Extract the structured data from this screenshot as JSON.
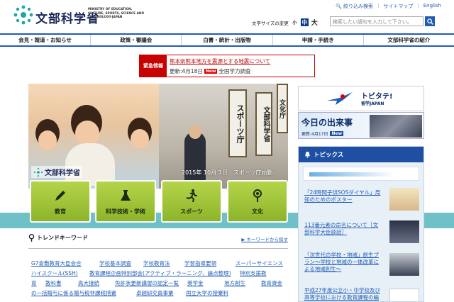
{
  "header": {
    "logo_text": "文部科学省",
    "logo_en": "MINISTRY OF EDUCATION, CULTURE, SPORTS, SCIENCE AND TECHNOLOGY-JAPAN",
    "top_links": [
      "絞り込み検索",
      "サイトマップ",
      "English"
    ],
    "font_size_label": "文字サイズの変更",
    "font_sizes": [
      "小",
      "中",
      "大"
    ],
    "search_placeholder": "検索したい語句を入力して下さい。"
  },
  "nav": [
    "会見・報道・お知らせ",
    "政策・審議会",
    "白書・統計・出版物",
    "申請・手続き",
    "文部科学省の紹介"
  ],
  "emergency": {
    "tag": "緊急情報",
    "line1": "熊本県熊本地方を震源とする地震について",
    "updated": "更新:4月18日",
    "new_badge": "New",
    "line2_text": "全国学力調査"
  },
  "hero": {
    "caption": "2015年 10月 1日　スポーツ庁始動",
    "sign_right": "スポーツ庁",
    "sign_left": "文部科学省",
    "sign_far": "文化庁",
    "logo_text": "文部科学省"
  },
  "tiles": [
    "教育",
    "科学技術・学術",
    "スポーツ",
    "文化"
  ],
  "trend": {
    "title": "トレンドキーワード",
    "more": "キーワードから探す",
    "keywords": [
      "G7倉敷教育大臣会合",
      "学校基本調査",
      "学校教育法",
      "学習指導要領",
      "スーパーサイエンス",
      "ハイスクール(SSH)",
      "教育課程企画特別部会(アクティブ・ラーニング、論点整理)",
      "特別支援教",
      "育",
      "教科書",
      "高大接続",
      "免許状更新講習の認定一覧",
      "奨学金",
      "地方創生",
      "教育資金",
      "の一括贈与に係る贈与税非課税措置",
      "卓越研究員事業",
      "国立大学の授業料"
    ]
  },
  "right": {
    "tobitate_title": "トビタテ!",
    "tobitate_sub": "留学JAPAN",
    "today_title": "今日の出来事",
    "today_updated": "更新:4月17日",
    "today_badge": "New",
    "topics_title": "トピックス",
    "topics": [
      "「24時間子供SOSダイヤル」周知のためのポスター",
      "113番元素の命名について［文部科学大臣談話］",
      "「次世代の学校・地域」創生プラン〜学校と地域の一体改革による地域創生〜",
      "平成27年度公立小・中学校及び高等学校における教育課程の編成・実施状況調査の"
    ]
  },
  "colors": {
    "brand": "#1f5cb8",
    "emergency": "#c80000",
    "tile_green": "#9cc43a",
    "teal": "#6fc1c7"
  }
}
